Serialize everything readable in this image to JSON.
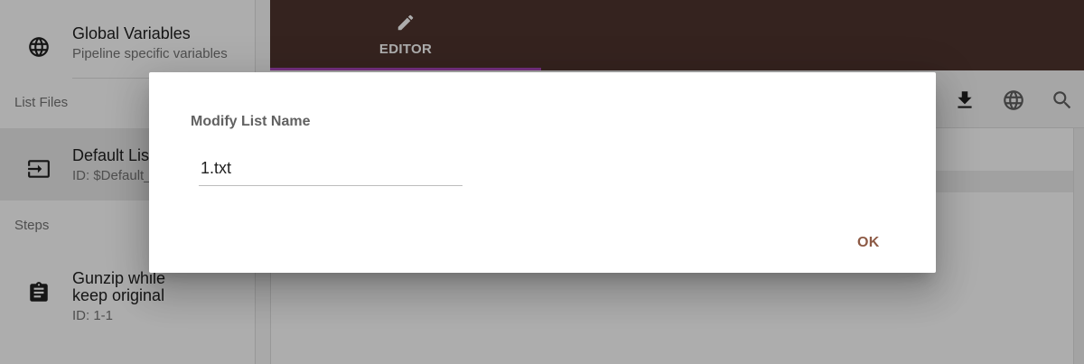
{
  "sidebar": {
    "global": {
      "title": "Global Variables",
      "subtitle": "Pipeline specific variables",
      "icon": "globe-icon"
    },
    "list_files_header": "List Files",
    "default_list": {
      "title": "Default List",
      "subtitle": "ID: $Default_List",
      "icon": "input-icon"
    },
    "steps_header": "Steps",
    "step": {
      "title": "Gunzip while keep original",
      "subtitle": "ID: 1-1",
      "icon": "clipboard-icon"
    }
  },
  "tabs": [
    {
      "label": "EDITOR",
      "icon": "pencil-icon"
    }
  ],
  "toolbar": {
    "icons": [
      "download-icon",
      "globe-icon",
      "search-icon"
    ]
  },
  "dialog": {
    "title": "Modify List Name",
    "input_value": "1.txt",
    "ok_label": "OK"
  },
  "colors": {
    "topbar": "#4e342e",
    "tab_indicator": "#ab47bc",
    "ok_button": "#8d5a45"
  }
}
